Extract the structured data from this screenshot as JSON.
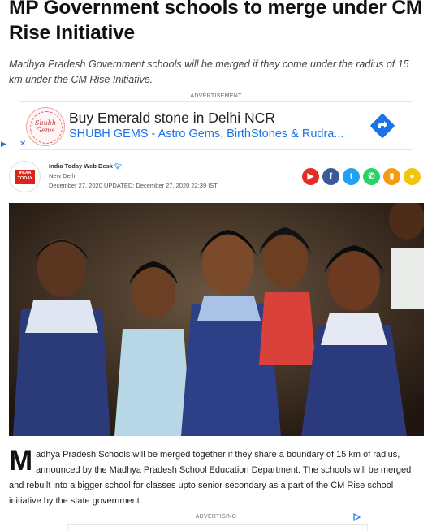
{
  "article": {
    "title": "MP Government schools to merge under CM Rise Initiative",
    "standfirst": "Madhya Pradesh Government schools will be merged if they come under the radius of 15 km under the CM Rise Initiative."
  },
  "ad": {
    "label": "ADVERTISEMENT",
    "logo_text": "Shubh Gems",
    "title": "Buy Emerald stone in Delhi NCR",
    "subtitle": "SHUBH GEMS - Astro Gems, BirthStones & Rudra...",
    "icons": [
      "adchoices-icon",
      "close-icon",
      "directions-arrow-icon"
    ]
  },
  "byline": {
    "logo_text": "INDIA TODAY",
    "author": "India Today Web Desk",
    "location": "New Delhi",
    "dates": "December 27, 2020 UPDATED: December 27, 2020 22:39 IST",
    "share_icons": [
      {
        "name": "youtube-icon",
        "color": "#e52d27"
      },
      {
        "name": "facebook-icon",
        "color": "#3b5998"
      },
      {
        "name": "twitter-icon",
        "color": "#1da1f2"
      },
      {
        "name": "whatsapp-icon",
        "color": "#25d366"
      },
      {
        "name": "bookmark-icon",
        "color": "#f39c12"
      },
      {
        "name": "comment-icon",
        "color": "#f1c40f"
      }
    ]
  },
  "body": {
    "dropcap": "M",
    "paragraph": "adhya Pradesh Schools will be merged together if they share a boundary of 15 km of radius, announced by the Madhya Pradesh School Education Department. The schools will be merged and rebuilt into a bigger school for classes upto senior secondary as a part of the CM Rise school initiative by the state government."
  },
  "footer_ad": {
    "label": "ADVERTISING"
  },
  "colors": {
    "brand_red": "#d7261e",
    "ad_link": "#1a73e8"
  }
}
